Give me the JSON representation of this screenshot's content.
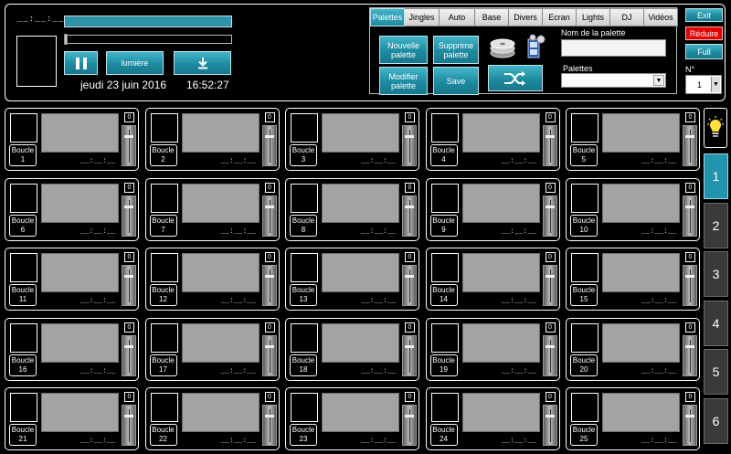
{
  "player": {
    "time_display": "__:__:__",
    "lumiere_label": "lumière",
    "date": "jeudi 23 juin 2016",
    "clock": "16:52:27"
  },
  "palette": {
    "tabs": [
      {
        "label": "Palettes",
        "active": true
      },
      {
        "label": "Jingles",
        "active": false
      },
      {
        "label": "Auto",
        "active": false
      },
      {
        "label": "Base",
        "active": false
      },
      {
        "label": "Divers",
        "active": false
      },
      {
        "label": "Ecran",
        "active": false
      },
      {
        "label": "Lights",
        "active": false
      },
      {
        "label": "DJ",
        "active": false
      },
      {
        "label": "Vidéos",
        "active": false
      }
    ],
    "buttons": {
      "nouvelle": "Nouvelle palette",
      "supprime": "Supprime palette",
      "modifier": "Modifier palette",
      "save": "Save"
    },
    "nom_label": "Nom de la palette",
    "nom_value": "",
    "palettes_label": "Palettes",
    "palettes_value": ""
  },
  "window": {
    "exit": "Exit",
    "reduire": "Réduire",
    "full": "Full",
    "n_label": "N°",
    "n_value": "1"
  },
  "loops": [
    {
      "label": "Boucle",
      "num": "1",
      "counter": "0",
      "time": "__:__:__"
    },
    {
      "label": "Boucle",
      "num": "2",
      "counter": "0",
      "time": "__:__:__"
    },
    {
      "label": "Boucle",
      "num": "3",
      "counter": "0",
      "time": "__:__:__"
    },
    {
      "label": "Boucle",
      "num": "4",
      "counter": "0",
      "time": "__:__:__"
    },
    {
      "label": "Boucle",
      "num": "5",
      "counter": "0",
      "time": "__:__:__"
    },
    {
      "label": "Boucle",
      "num": "6",
      "counter": "0",
      "time": "__:__:__"
    },
    {
      "label": "Boucle",
      "num": "7",
      "counter": "0",
      "time": "__:__:__"
    },
    {
      "label": "Boucle",
      "num": "8",
      "counter": "0",
      "time": "__:__:__"
    },
    {
      "label": "Boucle",
      "num": "9",
      "counter": "0",
      "time": "__:__:__"
    },
    {
      "label": "Boucle",
      "num": "10",
      "counter": "0",
      "time": "__:__:__"
    },
    {
      "label": "Boucle",
      "num": "11",
      "counter": "0",
      "time": "__:__:__"
    },
    {
      "label": "Boucle",
      "num": "12",
      "counter": "0",
      "time": "__:__:__"
    },
    {
      "label": "Boucle",
      "num": "13",
      "counter": "0",
      "time": "__:__:__"
    },
    {
      "label": "Boucle",
      "num": "14",
      "counter": "0",
      "time": "__:__:__"
    },
    {
      "label": "Boucle",
      "num": "15",
      "counter": "0",
      "time": "__:__:__"
    },
    {
      "label": "Boucle",
      "num": "16",
      "counter": "0",
      "time": "__:__:__"
    },
    {
      "label": "Boucle",
      "num": "17",
      "counter": "0",
      "time": "__:__:__"
    },
    {
      "label": "Boucle",
      "num": "18",
      "counter": "0",
      "time": "__:__:__"
    },
    {
      "label": "Boucle",
      "num": "19",
      "counter": "0",
      "time": "__:__:__"
    },
    {
      "label": "Boucle",
      "num": "20",
      "counter": "0",
      "time": "__:__:__"
    },
    {
      "label": "Boucle",
      "num": "21",
      "counter": "0",
      "time": "__:__:__"
    },
    {
      "label": "Boucle",
      "num": "22",
      "counter": "0",
      "time": "__:__:__"
    },
    {
      "label": "Boucle",
      "num": "23",
      "counter": "0",
      "time": "__:__:__"
    },
    {
      "label": "Boucle",
      "num": "24",
      "counter": "0",
      "time": "__:__:__"
    },
    {
      "label": "Boucle",
      "num": "25",
      "counter": "0",
      "time": "__:__:__"
    }
  ],
  "pages": [
    {
      "label": "1",
      "active": true
    },
    {
      "label": "2",
      "active": false
    },
    {
      "label": "3",
      "active": false
    },
    {
      "label": "4",
      "active": false
    },
    {
      "label": "5",
      "active": false
    },
    {
      "label": "6",
      "active": false
    }
  ],
  "icons": {
    "pause": "pause-icon",
    "download": "download-icon",
    "disc": "disc-stack-icon",
    "film": "film-projector-icon",
    "shuffle": "shuffle-icon",
    "bulb": "lightbulb-icon",
    "dropdown": "chevron-down-icon"
  },
  "colors": {
    "accent": "#2394ab",
    "reduire": "#e30000",
    "screen": "#a3a3a3",
    "bulb": "#ffe23a"
  }
}
